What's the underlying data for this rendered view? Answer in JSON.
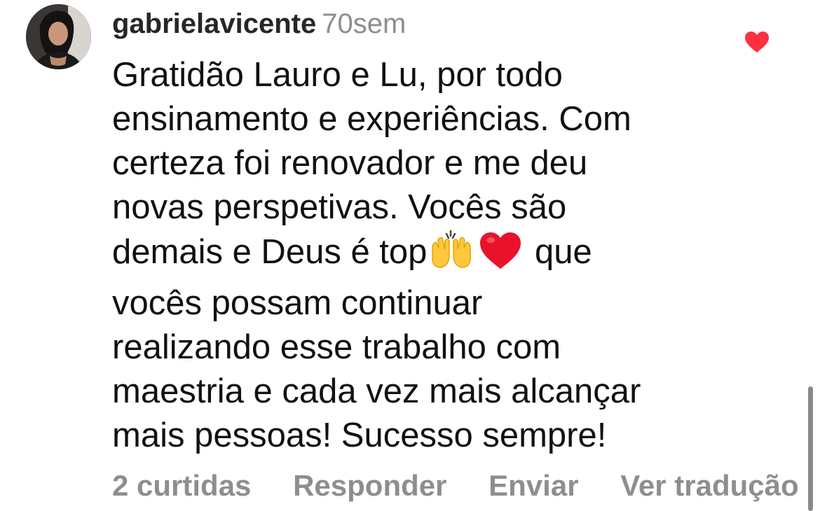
{
  "comment": {
    "username": "gabrielavicente",
    "timestamp": "70sem",
    "lines": [
      "Gratidão Lauro e Lu, por todo",
      "ensinamento e experiências. Com",
      "certeza foi renovador e me deu",
      "novas perspetivas. Vocês são",
      "demais e Deus é top",
      "que",
      "vocês possam continuar",
      "realizando esse trabalho com",
      "maestria e cada vez mais alcançar",
      "mais pessoas! Sucesso sempre!"
    ],
    "emojis": [
      "raising-hands-emoji",
      "red-heart-emoji"
    ],
    "liked": true,
    "like_color": "#ff3040"
  },
  "actions": {
    "likes_label": "2 curtidas",
    "reply_label": "Responder",
    "send_label": "Enviar",
    "translate_label": "Ver tradução"
  },
  "colors": {
    "text": "#111111",
    "muted": "#8e8e8e"
  }
}
